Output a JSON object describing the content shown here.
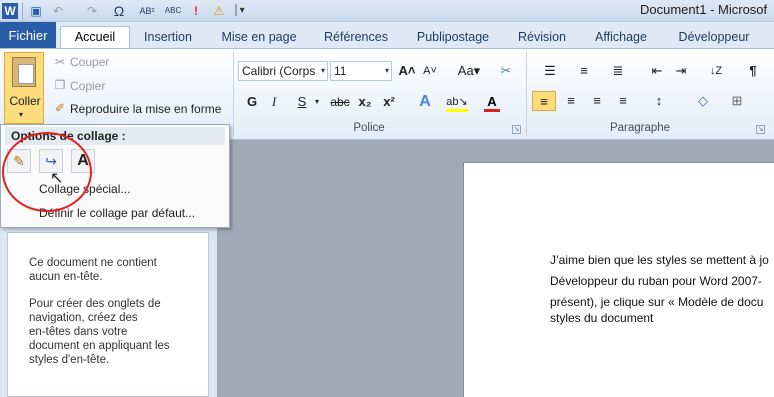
{
  "window": {
    "title": "Document1 - Microsof"
  },
  "qat": {
    "app_icon": "W",
    "undo": "↶",
    "redo": "↷",
    "omega": "Ω",
    "abc1": "AB²",
    "abc2": "ABC",
    "excl": "!",
    "warn": "⚠",
    "more": "│▾"
  },
  "tabs": {
    "file": "Fichier",
    "items": [
      "Accueil",
      "Insertion",
      "Mise en page",
      "Références",
      "Publipostage",
      "Révision",
      "Affichage",
      "Développeur"
    ]
  },
  "clipboard": {
    "paste_label": "Coller",
    "cut": "Couper",
    "copy": "Copier",
    "format_painter": "Reproduire la mise en forme"
  },
  "font": {
    "group_label": "Police",
    "font_name": "Calibri (Corps",
    "font_size": "11",
    "grow": "A˄",
    "shrink": "A˅",
    "case": "Aa▾",
    "clear": "✂",
    "bold": "G",
    "italic": "I",
    "underline": "S",
    "strike": "abc",
    "subscript": "x₂",
    "superscript": "x²",
    "effects": "A",
    "highlight": "ab↘",
    "color": "A"
  },
  "paragraph": {
    "group_label": "Paragraphe",
    "bullets": "☰",
    "numbering": "≡",
    "multilevel": "≣",
    "decrease_indent": "⇤",
    "increase_indent": "⇥",
    "sort": "↓Z",
    "pilcrow": "¶",
    "align_left": "≡",
    "center": "≡",
    "align_right": "≡",
    "justify": "≡",
    "spacing": "↕",
    "shading": "◇",
    "borders": "⊞"
  },
  "paste_menu": {
    "heading": "Options de collage :",
    "opt_keep": "✎",
    "opt_merge": "↪",
    "opt_text": "A",
    "special": "Collage spécial...",
    "default": "Définir le collage par défaut..."
  },
  "navpane": {
    "lines": [
      "Ce document ne contient",
      "aucun en-tête.",
      "",
      "Pour créer des onglets de",
      "navigation, créez des",
      "en-têtes dans votre",
      "document en appliquant les",
      "styles d'en-tête."
    ]
  },
  "document": {
    "lines": [
      "J’aime bien que les styles se mettent à jo",
      "Développeur du ruban pour Word 2007-",
      "présent), je clique sur « Modèle de docu",
      "styles du document"
    ]
  },
  "colors": {
    "accent": "#2a5da8",
    "highlight": "#fcdc7c",
    "annotation": "#e02020"
  }
}
